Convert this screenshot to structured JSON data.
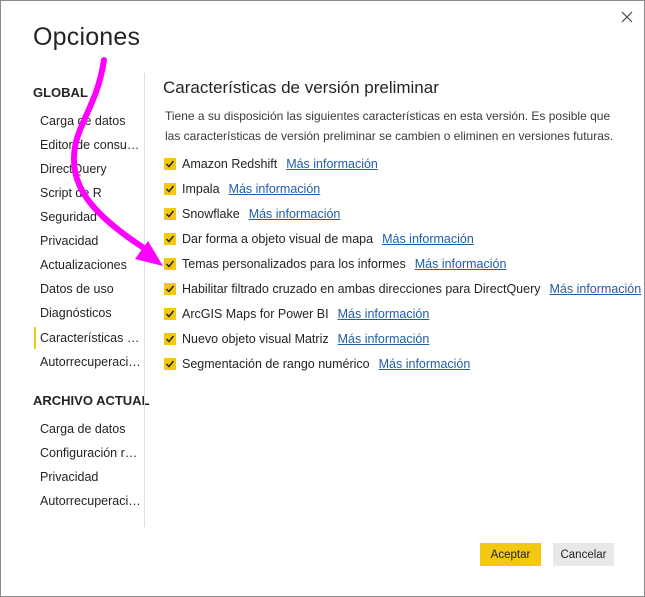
{
  "dialog": {
    "title": "Opciones",
    "close_icon": "close-icon"
  },
  "sidebar": {
    "global_header": "GLOBAL",
    "global_items": [
      {
        "label": "Carga de datos"
      },
      {
        "label": "Editor de consultas"
      },
      {
        "label": "DirectQuery"
      },
      {
        "label": "Script de R"
      },
      {
        "label": "Seguridad"
      },
      {
        "label": "Privacidad"
      },
      {
        "label": "Actualizaciones"
      },
      {
        "label": "Datos de uso"
      },
      {
        "label": "Diagnósticos"
      },
      {
        "label": "Características de versión preliminar"
      },
      {
        "label": "Autorrecuperación"
      }
    ],
    "current_file_header": "ARCHIVO ACTUAL",
    "current_items": [
      {
        "label": "Carga de datos"
      },
      {
        "label": "Configuración regional"
      },
      {
        "label": "Privacidad"
      },
      {
        "label": "Autorrecuperación"
      }
    ],
    "active_index": 9
  },
  "main": {
    "title": "Características de versión preliminar",
    "description": "Tiene a su disposición las siguientes características en esta versión. Es posible que las características de versión preliminar se cambien o eliminen en versiones futuras.",
    "features": [
      {
        "label": "Amazon Redshift",
        "link": "Más información",
        "checked": true
      },
      {
        "label": "Impala",
        "link": "Más información",
        "checked": true
      },
      {
        "label": "Snowflake",
        "link": "Más información",
        "checked": true
      },
      {
        "label": "Dar forma a objeto visual de mapa",
        "link": "Más información",
        "checked": true
      },
      {
        "label": "Temas personalizados para los informes",
        "link": "Más información",
        "checked": true
      },
      {
        "label": "Habilitar filtrado cruzado en ambas direcciones para DirectQuery",
        "link": "Más información",
        "checked": true
      },
      {
        "label": "ArcGIS Maps for Power BI",
        "link": "Más información",
        "checked": true
      },
      {
        "label": "Nuevo objeto visual Matriz",
        "link": "Más información",
        "checked": true
      },
      {
        "label": "Segmentación de rango numérico",
        "link": "Más información",
        "checked": true
      }
    ]
  },
  "buttons": {
    "ok": "Aceptar",
    "cancel": "Cancelar"
  },
  "colors": {
    "accent": "#f2c811",
    "link": "#1f5ea8",
    "annotation_arrow": "#ff00ff"
  }
}
